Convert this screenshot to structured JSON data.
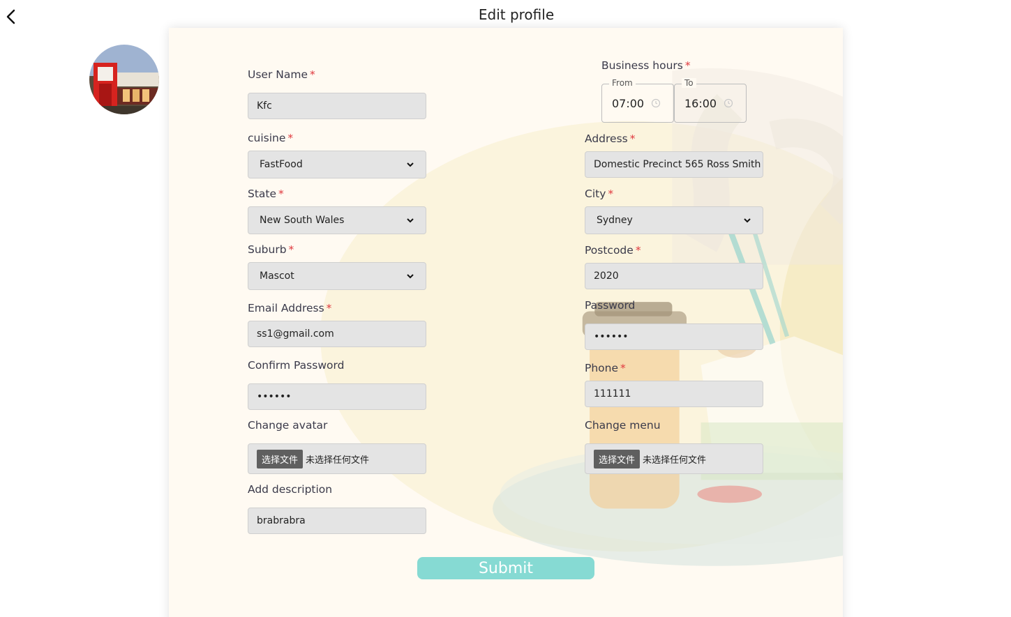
{
  "page": {
    "title": "Edit profile"
  },
  "form": {
    "user_name": {
      "label": "User Name",
      "value": "Kfc"
    },
    "cuisine": {
      "label": "cuisine",
      "selected": "FastFood"
    },
    "state": {
      "label": "State",
      "selected": "New South Wales"
    },
    "suburb": {
      "label": "Suburb",
      "selected": "Mascot"
    },
    "email": {
      "label": "Email Address",
      "value": "ss1@gmail.com"
    },
    "confirm_password": {
      "label": "Confirm Password",
      "value": "••••••"
    },
    "change_avatar": {
      "label": "Change avatar",
      "button": "选择文件",
      "status": "未选择任何文件"
    },
    "description": {
      "label": "Add description",
      "value": "brabrabra"
    },
    "business_hours": {
      "label": "Business hours",
      "from_label": "From",
      "from_value": "07:00",
      "to_label": "To",
      "to_value": "16:00"
    },
    "address": {
      "label": "Address",
      "value": "Domestic Precinct 565 Ross Smith"
    },
    "city": {
      "label": "City",
      "selected": "Sydney"
    },
    "postcode": {
      "label": "Postcode",
      "value": "2020"
    },
    "password": {
      "label": "Password",
      "value": "••••••"
    },
    "phone": {
      "label": "Phone",
      "value": "111111"
    },
    "change_menu": {
      "label": "Change menu",
      "button": "选择文件",
      "status": "未选择任何文件"
    },
    "required_mark": "*",
    "submit": "Submit"
  },
  "colors": {
    "accent": "#86dad3",
    "required": "#e0393e",
    "card_bg": "#fffaf2",
    "field_bg": "#e4e4e4"
  },
  "icons": [
    "chevron-left-icon",
    "chevron-down-icon",
    "clock-icon"
  ]
}
